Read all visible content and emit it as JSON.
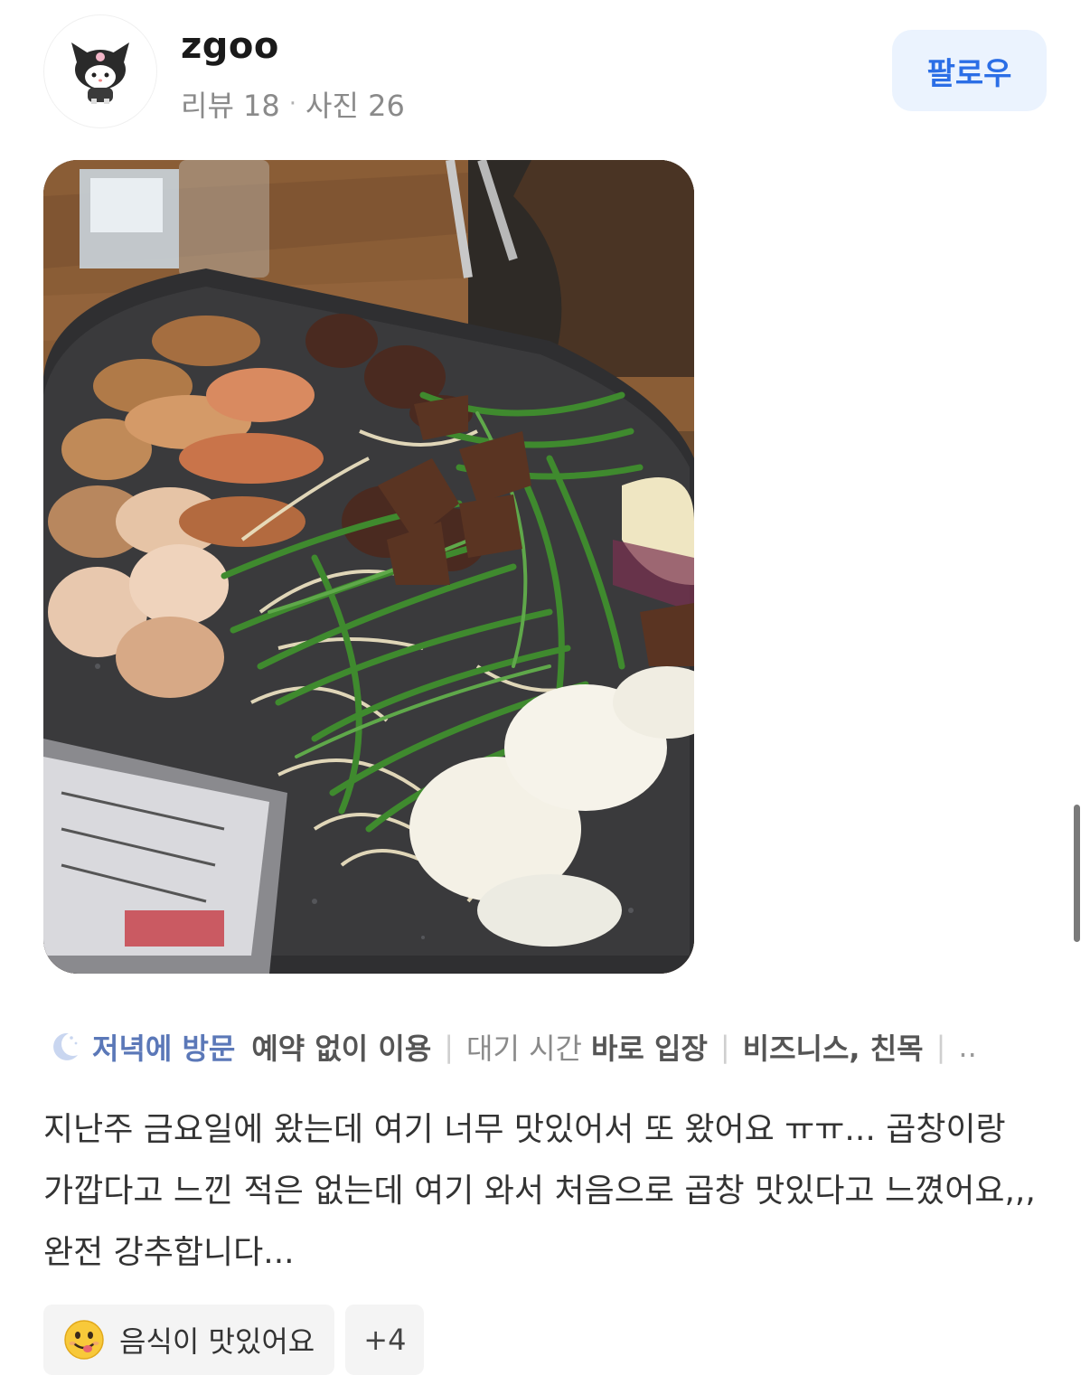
{
  "user": {
    "name": "zgoo",
    "review_count_label": "리뷰 18",
    "dot": "·",
    "photo_count_label": "사진 26",
    "follow_label": "팔로우",
    "avatar_icon": "kuromi-icon"
  },
  "visit": {
    "time_label": "저녁에 방문",
    "reservation": "예약 없이 이용",
    "wait_label": "대기 시간",
    "wait_value": "바로 입장",
    "purpose": "비즈니스, 친목",
    "separator": "|",
    "more": "..",
    "time_icon": "moon-icon"
  },
  "review": {
    "text": "지난주 금요일에 왔는데 여기 너무 맛있어서 또 왔어요 ㅠㅠ... 곱창이랑 가깝다고 느낀 적은 없는데 여기 와서 처음으로 곱창 맛있다고 느꼈어요,,, 완전 강추합니다..."
  },
  "keywords": {
    "first": "음식이 맛있어요",
    "first_icon": "yum-face-icon",
    "more": "+4"
  },
  "colors": {
    "follow_bg": "#ebf3fe",
    "follow_text": "#2b6ee6",
    "visit_time": "#5b78b8"
  }
}
